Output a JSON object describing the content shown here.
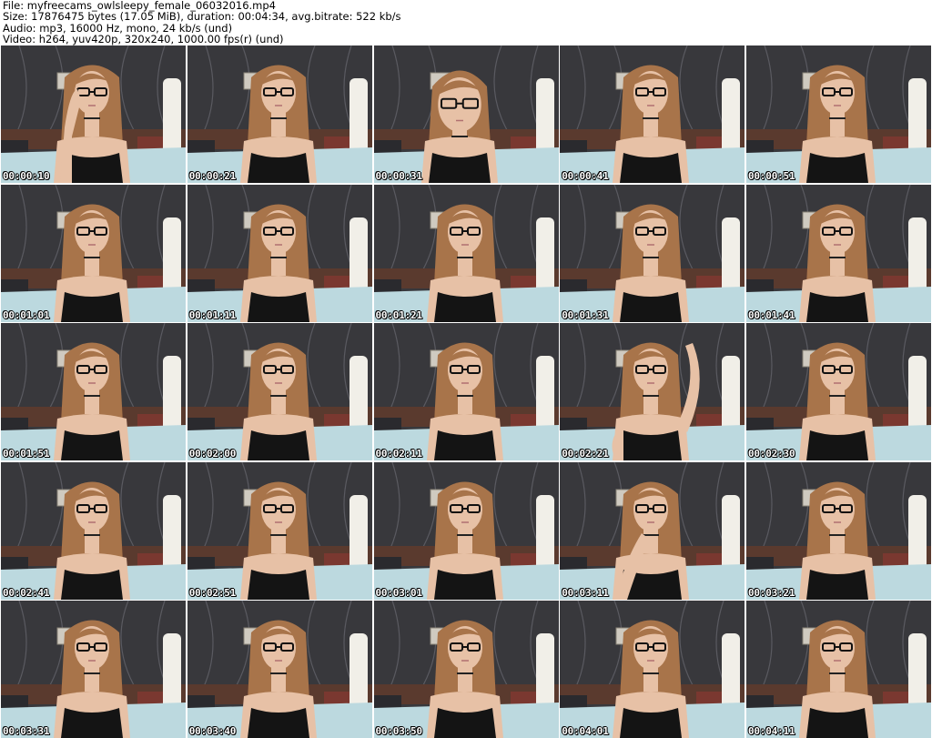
{
  "header": {
    "file_line": "File: myfreecams_owlsleepy_female_06032016.mp4",
    "size_line": "Size: 17876475 bytes (17.05 MiB), duration: 00:04:34, avg.bitrate: 522 kb/s",
    "audio_line": "Audio: mp3, 16000 Hz, mono, 24 kb/s (und)",
    "video_line": "Video: h264, yuv420p, 320x240, 1000.00 fps(r) (und)"
  },
  "thumbnails": [
    {
      "timestamp": "00:00:10",
      "pose": "hand-face"
    },
    {
      "timestamp": "00:00:21",
      "pose": "normal"
    },
    {
      "timestamp": "00:00:31",
      "pose": "close"
    },
    {
      "timestamp": "00:00:41",
      "pose": "normal"
    },
    {
      "timestamp": "00:00:51",
      "pose": "normal"
    },
    {
      "timestamp": "00:01:01",
      "pose": "normal"
    },
    {
      "timestamp": "00:01:11",
      "pose": "normal"
    },
    {
      "timestamp": "00:01:21",
      "pose": "normal"
    },
    {
      "timestamp": "00:01:31",
      "pose": "normal"
    },
    {
      "timestamp": "00:01:41",
      "pose": "normal"
    },
    {
      "timestamp": "00:01:51",
      "pose": "normal"
    },
    {
      "timestamp": "00:02:00",
      "pose": "normal"
    },
    {
      "timestamp": "00:02:11",
      "pose": "normal"
    },
    {
      "timestamp": "00:02:21",
      "pose": "arm-up"
    },
    {
      "timestamp": "00:02:30",
      "pose": "normal"
    },
    {
      "timestamp": "00:02:41",
      "pose": "normal"
    },
    {
      "timestamp": "00:02:51",
      "pose": "normal"
    },
    {
      "timestamp": "00:03:01",
      "pose": "normal"
    },
    {
      "timestamp": "00:03:11",
      "pose": "hand-chin"
    },
    {
      "timestamp": "00:03:21",
      "pose": "normal"
    },
    {
      "timestamp": "00:03:31",
      "pose": "normal"
    },
    {
      "timestamp": "00:03:40",
      "pose": "normal"
    },
    {
      "timestamp": "00:03:50",
      "pose": "normal"
    },
    {
      "timestamp": "00:04:01",
      "pose": "normal"
    },
    {
      "timestamp": "00:04:11",
      "pose": "normal"
    }
  ],
  "colors": {
    "wall": "#38383c",
    "bed": "#bcd9df",
    "lamp": "#f1efe8",
    "hair": "#a8744a",
    "skin": "#e7c1a6",
    "top": "#141414",
    "headboard": "#5a3a2e",
    "pillow": "#7a3830",
    "timestamp_text": "#ffffff"
  }
}
